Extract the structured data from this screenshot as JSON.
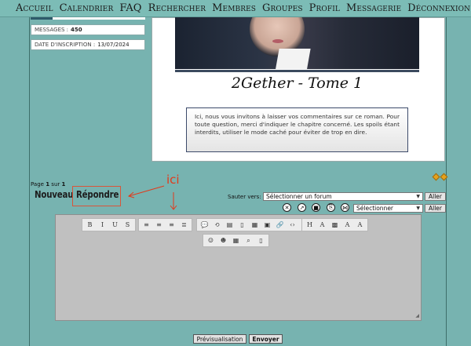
{
  "nav": {
    "items": [
      {
        "label": "Accueil"
      },
      {
        "label": "Calendrier"
      },
      {
        "label": "FAQ"
      },
      {
        "label": "Rechercher"
      },
      {
        "label": "Membres"
      },
      {
        "label": "Groupes"
      },
      {
        "label": "Profil"
      },
      {
        "label": "Messagerie"
      },
      {
        "label": "Déconnexion"
      }
    ]
  },
  "profile": {
    "messages_label": "MESSAGES :",
    "messages_value": "450",
    "inscription_label": "DATE D'INSCRIPTION :",
    "inscription_value": "13/07/2024"
  },
  "post": {
    "title": "2Gether - Tome 1",
    "notice": "Ici, nous vous invitons à laisser vos commentaires sur ce roman. Pour toute question, merci d'indiquer le chapitre concerné. Les spoils étant interdits, utiliser le mode caché pour éviter de trop en dire."
  },
  "pagination": {
    "prefix": "Page",
    "current": "1",
    "sep": "sur",
    "total": "1"
  },
  "actions": {
    "new_label": "Nouveau",
    "reply_label": "Répondre"
  },
  "annotation": {
    "text": "ici",
    "color": "#e23a1b"
  },
  "jump": {
    "label": "Sauter vers:",
    "selected": "Sélectionner un forum",
    "go": "Aller"
  },
  "moderation": {
    "selected": "Sélectionner",
    "go": "Aller"
  },
  "editor": {
    "toolbar_row1": [
      {
        "name": "bold-icon",
        "glyph": "B"
      },
      {
        "name": "italic-icon",
        "glyph": "I"
      },
      {
        "name": "underline-icon",
        "glyph": "U"
      },
      {
        "name": "strike-icon",
        "glyph": "S"
      },
      {
        "name": "align-left-icon",
        "glyph": "≡"
      },
      {
        "name": "align-center-icon",
        "glyph": "≡"
      },
      {
        "name": "align-right-icon",
        "glyph": "≡"
      },
      {
        "name": "align-justify-icon",
        "glyph": "≣"
      },
      {
        "name": "quote-icon",
        "glyph": "💬"
      },
      {
        "name": "code-icon",
        "glyph": "⟲"
      },
      {
        "name": "spoiler-icon",
        "glyph": "▤"
      },
      {
        "name": "hide-icon",
        "glyph": "▯"
      },
      {
        "name": "table-icon",
        "glyph": "▦"
      },
      {
        "name": "image-icon",
        "glyph": "▣"
      },
      {
        "name": "link-icon",
        "glyph": "🔗"
      },
      {
        "name": "html-icon",
        "glyph": "‹›"
      },
      {
        "name": "youtube-icon",
        "glyph": "▶"
      },
      {
        "name": "heading-icon",
        "glyph": "H"
      },
      {
        "name": "text-size-icon",
        "glyph": "A"
      },
      {
        "name": "color-icon",
        "glyph": "▩"
      },
      {
        "name": "font-icon",
        "glyph": "A"
      },
      {
        "name": "clear-format-icon",
        "glyph": "A"
      }
    ],
    "toolbar_row2": [
      {
        "name": "emoji-icon",
        "glyph": "☺"
      },
      {
        "name": "emoji-alt-icon",
        "glyph": "☻"
      },
      {
        "name": "date-icon",
        "glyph": "▦"
      },
      {
        "name": "search-replace-icon",
        "glyph": "⌕"
      },
      {
        "name": "new-document-icon",
        "glyph": "▯"
      }
    ]
  },
  "footer": {
    "preview_label": "Prévisualisation",
    "send_label": "Envoyer"
  },
  "colors": {
    "background": "#77b3b0",
    "nav": "#7cbcb6",
    "annotation": "#e23a1b",
    "notice_border": "#3c4a6a"
  }
}
